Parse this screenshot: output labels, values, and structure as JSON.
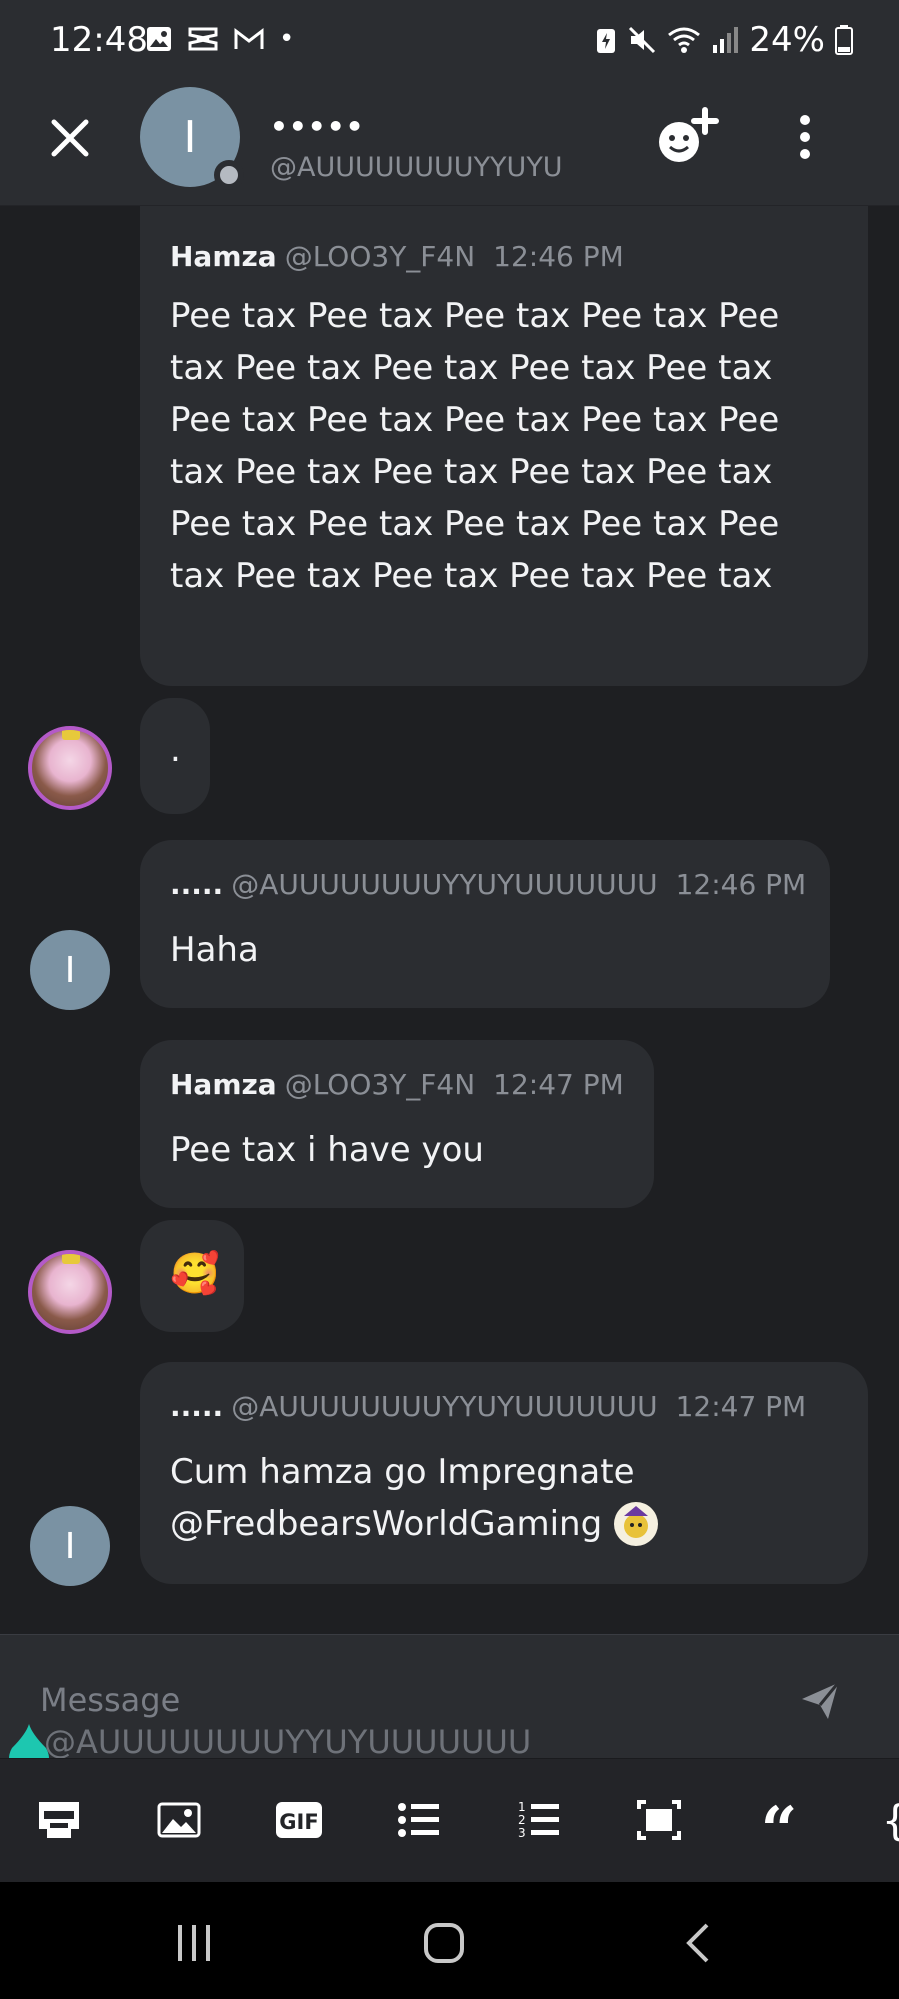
{
  "status_bar": {
    "time": "12:48",
    "battery_percent": "24%",
    "dot": "•"
  },
  "header": {
    "close_icon": "close-icon",
    "avatar_letter": "I",
    "name": "•••••",
    "username": "@AUUUUUUUUYYUYU",
    "add_friend_icon": "add-friend-icon",
    "more_icon": "more-vertical-icon"
  },
  "messages": [
    {
      "author": "Hamza",
      "username": "@LOO3Y_F4N",
      "time": "12:46 PM",
      "text": "Pee tax Pee tax Pee tax Pee tax Pee tax Pee tax Pee tax Pee tax Pee tax Pee tax Pee tax Pee tax Pee tax Pee tax Pee tax Pee tax Pee tax Pee tax Pee tax Pee tax Pee tax Pee tax Pee tax Pee tax Pee tax Pee tax Pee tax"
    },
    {
      "text": "."
    },
    {
      "author": ".....",
      "username": "@AUUUUUUUUYYUYUUUUUUU",
      "time": "12:46 PM",
      "text": "Haha"
    },
    {
      "author": "Hamza",
      "username": "@LOO3Y_F4N",
      "time": "12:47 PM",
      "text": "Pee tax i have you"
    },
    {
      "text": "🥰"
    },
    {
      "author": ".....",
      "username": "@AUUUUUUUUYYUYUUUUUUU",
      "time": "12:47 PM",
      "text_line1": "Cum hamza go Impregnate",
      "text_line2": "@FredbearsWorldGaming"
    }
  ],
  "input": {
    "placeholder": "Message",
    "reply_hint": "@AUUUUUUUUYYUYUUUUUUU",
    "send_icon": "send-icon"
  },
  "toolbar": {
    "items": [
      "keyboard-icon",
      "image-icon",
      "gif-icon",
      "bulleted-list-icon",
      "numbered-list-icon",
      "spoiler-icon",
      "quote-icon",
      "code-block-icon"
    ],
    "gif_label": "GIF",
    "quote_glyph": "“",
    "code_glyph": "{"
  },
  "navbar": {
    "items": [
      "recent-apps-icon",
      "home-icon",
      "back-icon"
    ]
  },
  "colors": {
    "background": "#1e1f22",
    "bubble": "#2b2d31",
    "avatar": "#7a92a3",
    "accent_teal": "#1dc7b0"
  }
}
